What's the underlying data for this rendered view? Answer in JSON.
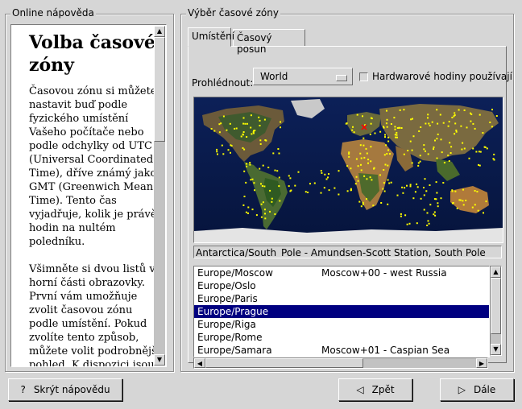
{
  "help": {
    "frame_title": "Online nápověda",
    "heading": "Volba časové zóny",
    "paragraphs": [
      "Časovou zónu si můžete nastavit buď podle fyzického umístění Vašeho počítače nebo podle odchylky od UTC (Universal Coordinated Time), dříve známý jako GMT (Greenwich Mean Time). Tento čas vyjadřuje, kolik je právě hodin na nultém poledníku.",
      "Všimněte si dvou listů v horní části obrazovky. První vám umožňuje zvolit časovou zónu podle umístění. Pokud zvolíte tento způsob, můžete volit podrobnější pohled. K dispozici jsou pohledy"
    ]
  },
  "timezone": {
    "frame_title": "Výběr časové zóny",
    "tabs": [
      "Umístění",
      "Časový posun"
    ],
    "active_tab": 0,
    "browse_label": "Prohlédnout:",
    "browse_value": "World",
    "hw_clock_label": "Hardwarové hodiny používají",
    "hw_clock_checked": false,
    "status": "Antarctica/South_Pole  -  Amundsen-Scott Station, South Pole",
    "list": [
      {
        "zone": "Europe/Moscow",
        "desc": "Moscow+00 - west Russia"
      },
      {
        "zone": "Europe/Oslo",
        "desc": ""
      },
      {
        "zone": "Europe/Paris",
        "desc": ""
      },
      {
        "zone": "Europe/Prague",
        "desc": ""
      },
      {
        "zone": "Europe/Riga",
        "desc": ""
      },
      {
        "zone": "Europe/Rome",
        "desc": ""
      },
      {
        "zone": "Europe/Samara",
        "desc": "Moscow+01 - Caspian Sea"
      }
    ],
    "selected_zone": "Europe/Prague"
  },
  "buttons": {
    "hide_help": "Skrýt nápovědu",
    "back": "Zpět",
    "next": "Dále"
  },
  "colors": {
    "selection": "#000080",
    "city_dot": "#ffff00",
    "selected_city": "#ff0000",
    "ocean": "#0a1e50"
  }
}
